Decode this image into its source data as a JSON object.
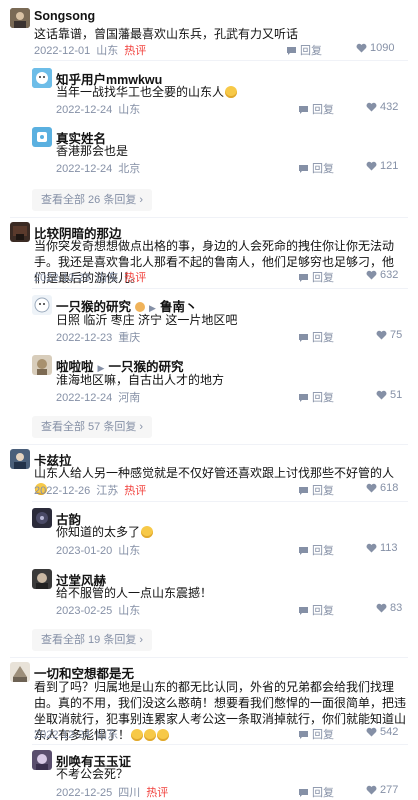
{
  "comments": [
    {
      "name": "Songsong",
      "text": "这话靠谱，曾国藩最喜欢山东兵，孔武有力又听话",
      "date": "2022-12-01",
      "location": "山东",
      "hot": "热评",
      "reply": "回复",
      "likes": "1090"
    },
    {
      "name": "知乎用户mmwkwu",
      "text": "当年一战找华工也全要的山东人",
      "date": "2022-12-24",
      "location": "山东",
      "reply": "回复",
      "likes": "432"
    },
    {
      "name": "真实姓名",
      "text": "香港那会也是",
      "date": "2022-12-24",
      "location": "北京",
      "reply": "回复",
      "likes": "121"
    },
    {
      "more": "查看全部 26 条回复"
    },
    {
      "name": "比较阴暗的那边",
      "text": "当你突发奇想想做点出格的事，身边的人会死命的拽住你让你无法动手。我还是喜欢鲁北人那看不起的鲁南人，他们足够穷也足够刁，他们是最后的游侠儿。",
      "date": "2022-12-23",
      "location": "山东",
      "hot": "热评",
      "reply": "回复",
      "likes": "632"
    },
    {
      "name": "一只猴的研究",
      "reply_to": "鲁南丶",
      "text": "日照 临沂 枣庄 济宁 这一片地区吧",
      "date": "2022-12-23",
      "location": "重庆",
      "reply": "回复",
      "likes": "75"
    },
    {
      "name": "啦啦啦",
      "reply_to": "一只猴的研究",
      "text": "淮海地区嘛，自古出人才的地方",
      "date": "2022-12-24",
      "location": "河南",
      "reply": "回复",
      "likes": "51"
    },
    {
      "more": "查看全部 57 条回复"
    },
    {
      "name": "卡兹拉",
      "text": "山东人给人另一种感觉就是不仅好管还喜欢跟上讨伐那些不好管的人",
      "date": "2022-12-26",
      "location": "江苏",
      "hot": "热评",
      "reply": "回复",
      "likes": "618"
    },
    {
      "name": "古韵",
      "text": "你知道的太多了",
      "date": "2023-01-20",
      "location": "山东",
      "reply": "回复",
      "likes": "113"
    },
    {
      "name": "过堂风赫",
      "text": "给不服管的人一点山东震撼！",
      "date": "2023-02-25",
      "location": "山东",
      "reply": "回复",
      "likes": "83"
    },
    {
      "more": "查看全部 19 条回复"
    },
    {
      "name": "一切和空想都是无",
      "text": "看到了吗？归属地是山东的都无比认同，外省的兄弟都会给我们找理由。真的不用，我们没这么憨萌！想要看我们憋悍的一面很简单，把违坐取消就行，犯事别连累家人考公这一条取消掉就行，你们就能知道山东人有多彪悍了！",
      "date": "2022-12-24",
      "location": "山东",
      "reply": "回复",
      "likes": "542"
    },
    {
      "name": "别唤有玉玉证",
      "text": "不考公会死？",
      "date": "2022-12-25",
      "location": "四川",
      "hot": "热评",
      "reply": "回复",
      "likes": "277"
    }
  ]
}
